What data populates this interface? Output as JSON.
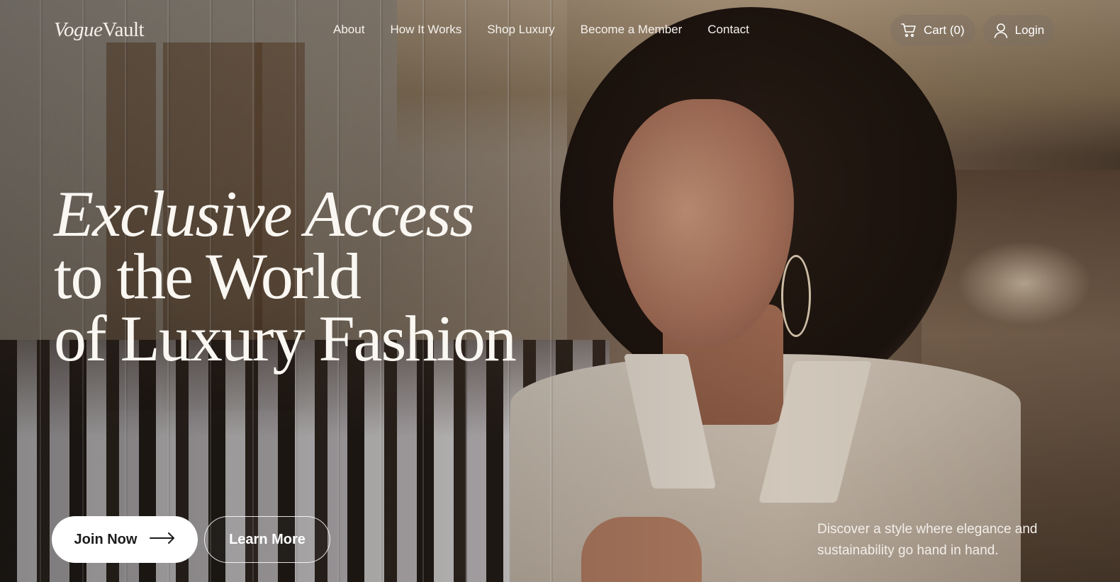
{
  "brand": {
    "logo_part1": "Vogue",
    "logo_part2": "Vault"
  },
  "nav": {
    "links": [
      {
        "label": "About"
      },
      {
        "label": "How It Works"
      },
      {
        "label": "Shop Luxury"
      },
      {
        "label": "Become a Member"
      },
      {
        "label": "Contact"
      }
    ],
    "cart_label": "Cart (0)",
    "login_label": "Login",
    "cart_icon": "cart-icon",
    "login_icon": "user-icon"
  },
  "hero": {
    "title_line1": "Exclusive Access",
    "title_line2": "to the World",
    "title_line3": "of Luxury Fashion",
    "tagline": "Discover a style where elegance and sustainability go hand in hand.",
    "primary_button": "Join Now",
    "primary_button_icon": "arrow-right-icon",
    "secondary_button": "Learn More",
    "background_image": "woman-browsing-clothing-rack-photo"
  },
  "colors": {
    "text": "#ffffff",
    "button_bg": "#ffffff",
    "button_text": "#1c1c1c"
  }
}
